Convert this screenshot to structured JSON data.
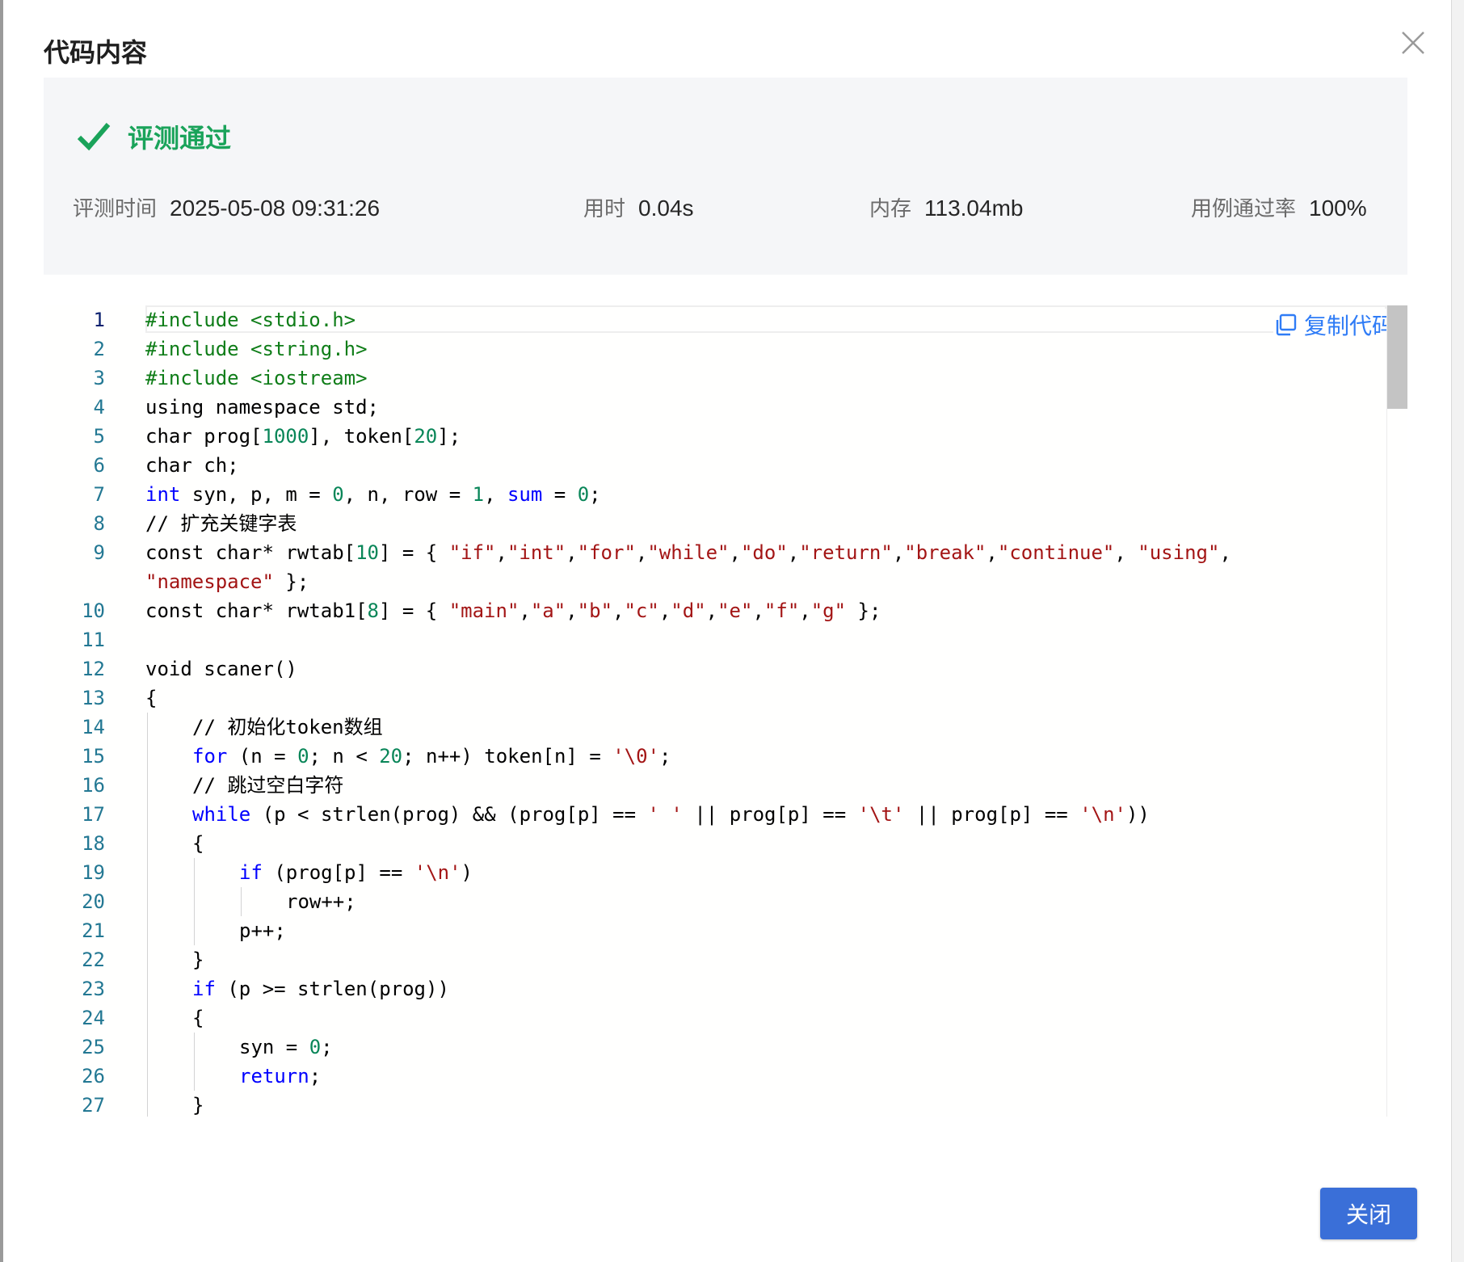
{
  "dialog": {
    "title": "代码内容",
    "close_button_label": "关闭"
  },
  "summary": {
    "status": "评测通过",
    "judge_time_label": "评测时间",
    "judge_time_value": "2025-05-08 09:31:26",
    "time_used_label": "用时",
    "time_used_value": "0.04s",
    "memory_label": "内存",
    "memory_value": "113.04mb",
    "pass_rate_label": "用例通过率",
    "pass_rate_value": "100%"
  },
  "code": {
    "copy_label": "复制代码",
    "lines": [
      {
        "n": "1",
        "indent": 0,
        "tokens": [
          [
            "pp",
            "#include <stdio.h>"
          ]
        ]
      },
      {
        "n": "2",
        "indent": 0,
        "tokens": [
          [
            "pp",
            "#include <string.h>"
          ]
        ]
      },
      {
        "n": "3",
        "indent": 0,
        "tokens": [
          [
            "pp",
            "#include <iostream>"
          ]
        ]
      },
      {
        "n": "4",
        "indent": 0,
        "tokens": [
          [
            "",
            "using namespace std;"
          ]
        ]
      },
      {
        "n": "5",
        "indent": 0,
        "tokens": [
          [
            "",
            "char prog["
          ],
          [
            "num",
            "1000"
          ],
          [
            "",
            "], token["
          ],
          [
            "num",
            "20"
          ],
          [
            "",
            "];"
          ]
        ]
      },
      {
        "n": "6",
        "indent": 0,
        "tokens": [
          [
            "",
            "char ch;"
          ]
        ]
      },
      {
        "n": "7",
        "indent": 0,
        "tokens": [
          [
            "kw",
            "int"
          ],
          [
            "",
            " syn, p, m = "
          ],
          [
            "num",
            "0"
          ],
          [
            "",
            ", n, row = "
          ],
          [
            "num",
            "1"
          ],
          [
            "",
            ", "
          ],
          [
            "kw",
            "sum"
          ],
          [
            "",
            " = "
          ],
          [
            "num",
            "0"
          ],
          [
            "",
            ";"
          ]
        ]
      },
      {
        "n": "8",
        "indent": 0,
        "tokens": [
          [
            "",
            "// 扩充关键字表"
          ]
        ]
      },
      {
        "n": "9",
        "indent": 0,
        "tokens": [
          [
            "",
            "const char* rwtab["
          ],
          [
            "num",
            "10"
          ],
          [
            "",
            "] = { "
          ],
          [
            "str",
            "\"if\""
          ],
          [
            "",
            ","
          ],
          [
            "str",
            "\"int\""
          ],
          [
            "",
            ","
          ],
          [
            "str",
            "\"for\""
          ],
          [
            "",
            ","
          ],
          [
            "str",
            "\"while\""
          ],
          [
            "",
            ","
          ],
          [
            "str",
            "\"do\""
          ],
          [
            "",
            ","
          ],
          [
            "str",
            "\"return\""
          ],
          [
            "",
            ","
          ],
          [
            "str",
            "\"break\""
          ],
          [
            "",
            ","
          ],
          [
            "str",
            "\"continue\""
          ],
          [
            "",
            ", "
          ],
          [
            "str",
            "\"using\""
          ],
          [
            "",
            ","
          ]
        ]
      },
      {
        "n": "",
        "indent": 0,
        "tokens": [
          [
            "str",
            "\"namespace\""
          ],
          [
            "",
            " };"
          ]
        ]
      },
      {
        "n": "10",
        "indent": 0,
        "tokens": [
          [
            "",
            "const char* rwtab1["
          ],
          [
            "num",
            "8"
          ],
          [
            "",
            "] = { "
          ],
          [
            "str",
            "\"main\""
          ],
          [
            "",
            ","
          ],
          [
            "str",
            "\"a\""
          ],
          [
            "",
            ","
          ],
          [
            "str",
            "\"b\""
          ],
          [
            "",
            ","
          ],
          [
            "str",
            "\"c\""
          ],
          [
            "",
            ","
          ],
          [
            "str",
            "\"d\""
          ],
          [
            "",
            ","
          ],
          [
            "str",
            "\"e\""
          ],
          [
            "",
            ","
          ],
          [
            "str",
            "\"f\""
          ],
          [
            "",
            ","
          ],
          [
            "str",
            "\"g\""
          ],
          [
            "",
            " };"
          ]
        ]
      },
      {
        "n": "11",
        "indent": 0,
        "tokens": []
      },
      {
        "n": "12",
        "indent": 0,
        "tokens": [
          [
            "",
            "void scaner()"
          ]
        ]
      },
      {
        "n": "13",
        "indent": 0,
        "tokens": [
          [
            "",
            "{"
          ]
        ]
      },
      {
        "n": "14",
        "indent": 1,
        "tokens": [
          [
            "",
            "// 初始化token数组"
          ]
        ]
      },
      {
        "n": "15",
        "indent": 1,
        "tokens": [
          [
            "kw",
            "for"
          ],
          [
            "",
            " (n = "
          ],
          [
            "num",
            "0"
          ],
          [
            "",
            "; n < "
          ],
          [
            "num",
            "20"
          ],
          [
            "",
            "; n++) token[n] = "
          ],
          [
            "str",
            "'\\0'"
          ],
          [
            "",
            ";"
          ]
        ]
      },
      {
        "n": "16",
        "indent": 1,
        "tokens": [
          [
            "",
            "// 跳过空白字符"
          ]
        ]
      },
      {
        "n": "17",
        "indent": 1,
        "tokens": [
          [
            "kw",
            "while"
          ],
          [
            "",
            " (p < strlen(prog) && (prog[p] == "
          ],
          [
            "str",
            "' '"
          ],
          [
            "",
            " || prog[p] == "
          ],
          [
            "str",
            "'\\t'"
          ],
          [
            "",
            " || prog[p] == "
          ],
          [
            "str",
            "'\\n'"
          ],
          [
            "",
            "))"
          ]
        ]
      },
      {
        "n": "18",
        "indent": 1,
        "tokens": [
          [
            "",
            "{"
          ]
        ]
      },
      {
        "n": "19",
        "indent": 2,
        "tokens": [
          [
            "kw",
            "if"
          ],
          [
            "",
            " (prog[p] == "
          ],
          [
            "str",
            "'\\n'"
          ],
          [
            "",
            ")"
          ]
        ]
      },
      {
        "n": "20",
        "indent": 3,
        "tokens": [
          [
            "",
            "row++;"
          ]
        ]
      },
      {
        "n": "21",
        "indent": 2,
        "tokens": [
          [
            "",
            "p++;"
          ]
        ]
      },
      {
        "n": "22",
        "indent": 1,
        "tokens": [
          [
            "",
            "}"
          ]
        ]
      },
      {
        "n": "23",
        "indent": 1,
        "tokens": [
          [
            "kw",
            "if"
          ],
          [
            "",
            " (p >= strlen(prog))"
          ]
        ]
      },
      {
        "n": "24",
        "indent": 1,
        "tokens": [
          [
            "",
            "{"
          ]
        ]
      },
      {
        "n": "25",
        "indent": 2,
        "tokens": [
          [
            "",
            "syn = "
          ],
          [
            "num",
            "0"
          ],
          [
            "",
            ";"
          ]
        ]
      },
      {
        "n": "26",
        "indent": 2,
        "tokens": [
          [
            "kw",
            "return"
          ],
          [
            "",
            ";"
          ]
        ]
      },
      {
        "n": "27",
        "indent": 1,
        "tokens": [
          [
            "",
            "}"
          ]
        ]
      }
    ]
  }
}
